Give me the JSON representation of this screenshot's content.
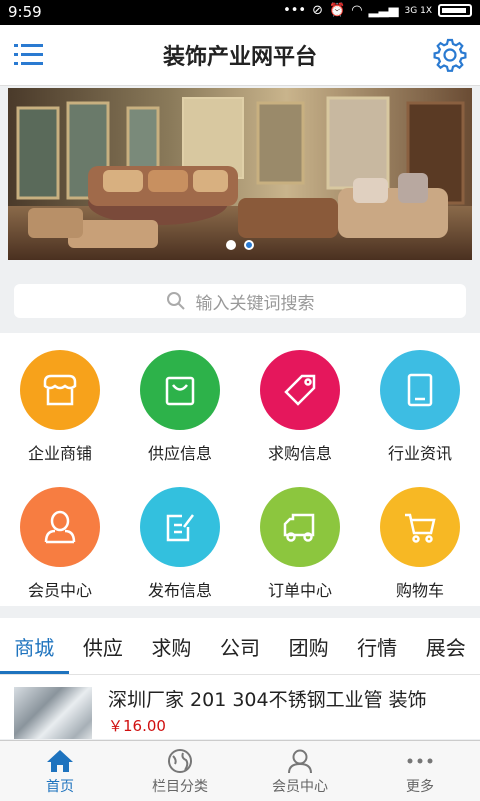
{
  "status_bar": {
    "time": "9:59",
    "network": "3G 1X"
  },
  "header": {
    "title": "装饰产业网平台"
  },
  "banner": {
    "dots": 2,
    "active_dot": 2
  },
  "search": {
    "placeholder": "输入关键词搜索"
  },
  "grid": [
    {
      "label": "企业商铺",
      "icon": "shop-icon",
      "color": "#f7a21b"
    },
    {
      "label": "供应信息",
      "icon": "shopping-bag-icon",
      "color": "#2db24a"
    },
    {
      "label": "求购信息",
      "icon": "tag-icon",
      "color": "#e5175c"
    },
    {
      "label": "行业资讯",
      "icon": "tablet-icon",
      "color": "#3dbde3"
    },
    {
      "label": "会员中心",
      "icon": "user-icon",
      "color": "#f77d41"
    },
    {
      "label": "发布信息",
      "icon": "edit-icon",
      "color": "#33c0de"
    },
    {
      "label": "订单中心",
      "icon": "truck-icon",
      "color": "#8cc63e"
    },
    {
      "label": "购物车",
      "icon": "cart-icon",
      "color": "#f7b824"
    }
  ],
  "tabs": [
    "商城",
    "供应",
    "求购",
    "公司",
    "团购",
    "行情",
    "展会"
  ],
  "active_tab": 0,
  "product": {
    "title": "深圳厂家 201 304不锈钢工业管 装饰",
    "price": "￥16.00"
  },
  "bottom_nav": [
    {
      "label": "首页",
      "icon": "home-icon"
    },
    {
      "label": "栏目分类",
      "icon": "globe-icon"
    },
    {
      "label": "会员中心",
      "icon": "user-icon"
    },
    {
      "label": "更多",
      "icon": "more-icon"
    }
  ],
  "colors": {
    "accent": "#1e73be",
    "price": "#d01010"
  }
}
